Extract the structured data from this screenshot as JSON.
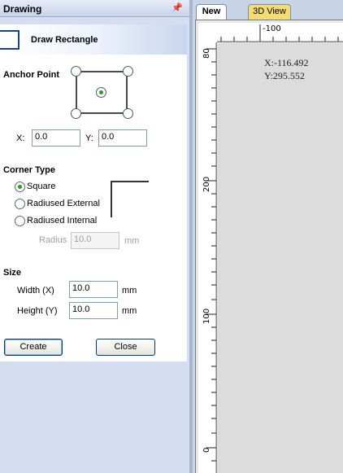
{
  "panel": {
    "title": "Drawing",
    "pin_icon": "pin-icon",
    "tool_icon": "rectangle-icon",
    "tool_label": "Draw Rectangle"
  },
  "anchor": {
    "label": "Anchor Point",
    "selected": "center",
    "x_label": "X:",
    "x_value": "0.0",
    "y_label": "Y:",
    "y_value": "0.0"
  },
  "corner": {
    "label": "Corner Type",
    "options": [
      "Square",
      "Radiused External",
      "Radiused Internal"
    ],
    "selected": "Square",
    "radius_label": "Radius",
    "radius_value": "10.0",
    "radius_unit": "mm"
  },
  "size": {
    "label": "Size",
    "width_label": "Width (X)",
    "width_value": "10.0",
    "width_unit": "mm",
    "height_label": "Height (Y)",
    "height_value": "10.0",
    "height_unit": "mm"
  },
  "buttons": {
    "create": "Create",
    "close": "Close"
  },
  "view": {
    "tabs": [
      "New",
      "3D View"
    ],
    "active_tab": "New",
    "ruler_top_label": "-100",
    "ruler_left_labels": [
      "0",
      "100",
      "200",
      "80"
    ],
    "cursor_x": "X:-116.492",
    "cursor_y": "Y:295.552"
  },
  "colors": {
    "panel_bg": "#d4def0",
    "tab_inactive": "#f5dc72",
    "selection_green": "#2a9a2a"
  }
}
